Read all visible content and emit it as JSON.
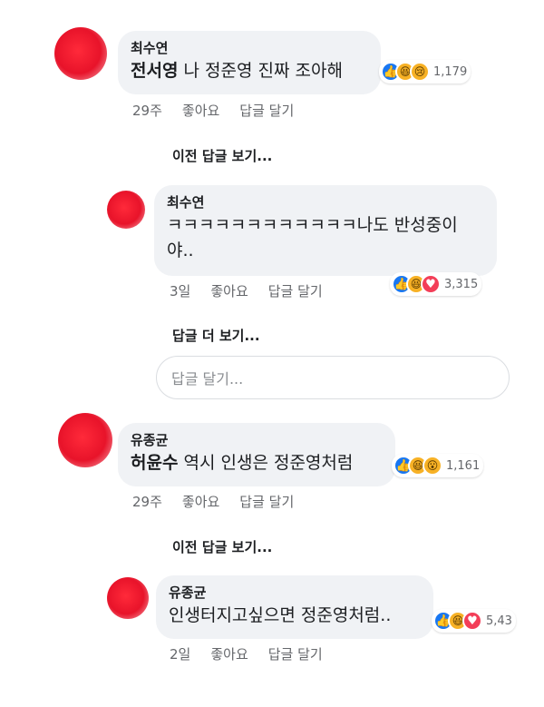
{
  "comments": [
    {
      "author": "최수연",
      "mention": "전서영",
      "text": " 나 정준영 진짜 조아해",
      "reaction_count": "1,179",
      "reactions": [
        "like-icon",
        "haha-icon",
        "sad-icon"
      ],
      "time": "29주",
      "like_label": "좋아요",
      "reply_label": "답글 달기"
    },
    {
      "author": "최수연",
      "mention": "",
      "text": "ㅋㅋㅋㅋㅋㅋㅋㅋㅋㅋㅋㅋ나도 반성중이야..",
      "reaction_count": "3,315",
      "reactions": [
        "like-icon",
        "haha-icon",
        "love-icon"
      ],
      "time": "3일",
      "like_label": "좋아요",
      "reply_label": "답글 달기"
    },
    {
      "author": "유종균",
      "mention": "허윤수",
      "text": " 역시 인생은 정준영처럼",
      "reaction_count": "1,161",
      "reactions": [
        "like-icon",
        "haha-icon",
        "wow-icon"
      ],
      "time": "29주",
      "like_label": "좋아요",
      "reply_label": "답글 달기"
    },
    {
      "author": "유종균",
      "mention": "",
      "text": "인생터지고싶으면 정준영처럼..",
      "reaction_count": "5,43",
      "reactions": [
        "like-icon",
        "haha-icon",
        "love-icon"
      ],
      "time": "2일",
      "like_label": "좋아요",
      "reply_label": "답글 달기"
    }
  ],
  "view_previous_1": "이전 답글 보기...",
  "view_more": "답글 더 보기...",
  "reply_placeholder": "답글 달기...",
  "view_previous_2": "이전 답글 보기..."
}
